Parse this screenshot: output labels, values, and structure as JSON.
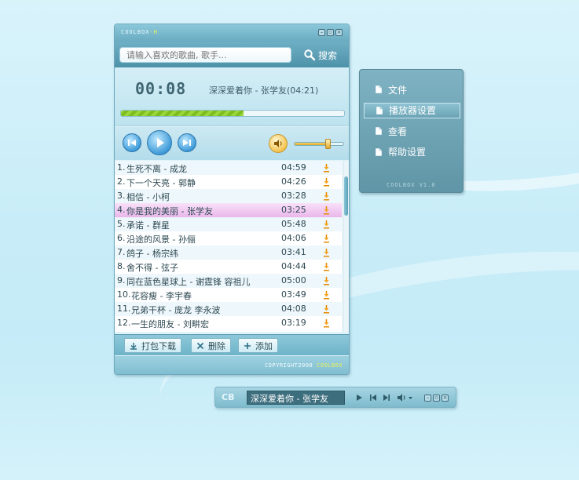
{
  "player": {
    "brand": "COOLBOX",
    "brand_suffix": "-H",
    "search": {
      "placeholder": "请输入喜欢的歌曲, 歌手...",
      "button_label": "搜索"
    },
    "timer": "00:08",
    "now_playing": "深深爱着你 - 张学友(04:21)",
    "progress": 0.55,
    "volume": 0.7,
    "playlist": [
      {
        "no": "1.",
        "title": "生死不离 - 成龙",
        "duration": "04:59"
      },
      {
        "no": "2.",
        "title": "下一个天亮 - 郭静",
        "duration": "04:26"
      },
      {
        "no": "3.",
        "title": "相信 - 小柯",
        "duration": "03:28"
      },
      {
        "no": "4.",
        "title": "你是我的美丽 - 张学友",
        "duration": "03:25"
      },
      {
        "no": "5.",
        "title": "承诺 - 群星",
        "duration": "05:48"
      },
      {
        "no": "6.",
        "title": "沿途的风景 - 孙俪",
        "duration": "04:06"
      },
      {
        "no": "7.",
        "title": "鸽子 - 杨宗纬",
        "duration": "03:41"
      },
      {
        "no": "8.",
        "title": "舍不得 - 弦子",
        "duration": "04:44"
      },
      {
        "no": "9.",
        "title": "同在蓝色星球上 - 谢霆锋 容祖儿",
        "duration": "05:00"
      },
      {
        "no": "10.",
        "title": "花容瘦 - 李宇春",
        "duration": "03:49"
      },
      {
        "no": "11.",
        "title": "兄弟干杯 - 庞龙 李永波",
        "duration": "04:08"
      },
      {
        "no": "12.",
        "title": "一生的朋友 - 刘畊宏",
        "duration": "03:19"
      }
    ],
    "active_index": 3,
    "actions": {
      "download_label": "打包下载",
      "delete_label": "删除",
      "add_label": "添加"
    },
    "copyright": "COPYRIGHT2008",
    "copyright_brand": "COOLBOX"
  },
  "menu": {
    "items": [
      {
        "label": "文件"
      },
      {
        "label": "播放器设置"
      },
      {
        "label": "查看"
      },
      {
        "label": "帮助设置"
      }
    ],
    "selected_index": 1,
    "version": "COOLBOX V1.0"
  },
  "mini_player": {
    "logo": "CB",
    "title": "深深爱着你 - 张学友"
  },
  "colors": {
    "accent": "#4e92a9",
    "highlight_row": "#e9b7ea",
    "progress": "#9bd63a"
  }
}
